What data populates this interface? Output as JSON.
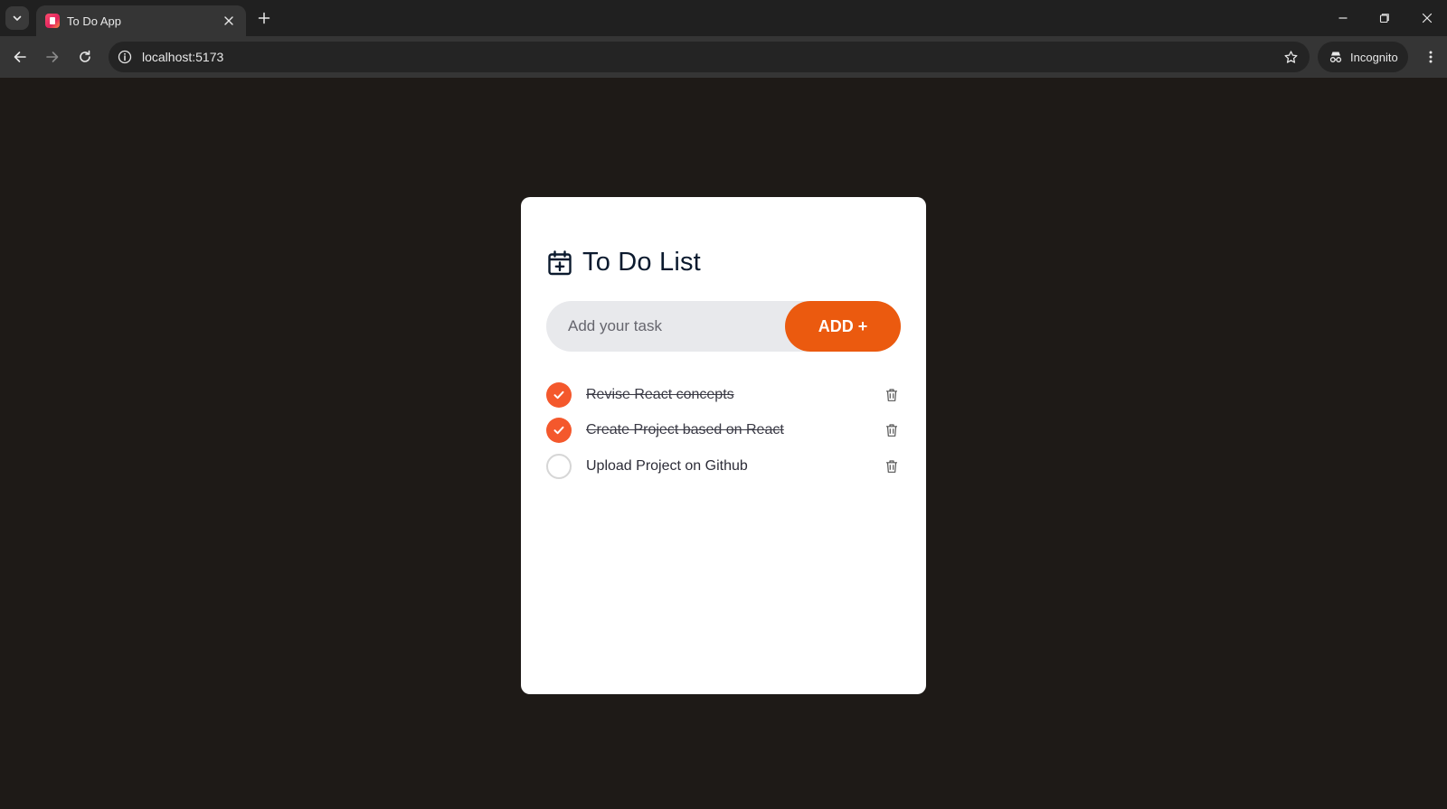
{
  "browser": {
    "tab_title": "To Do App",
    "url": "localhost:5173",
    "incognito_label": "Incognito"
  },
  "app": {
    "title": "To Do List",
    "input": {
      "placeholder": "Add your task",
      "value": ""
    },
    "add_button_label": "ADD +",
    "tasks": [
      {
        "text": "Revise React concepts",
        "completed": true
      },
      {
        "text": "Create Project based on React",
        "completed": true
      },
      {
        "text": "Upload Project on Github",
        "completed": false
      }
    ]
  },
  "colors": {
    "page_background": "#1e1a17",
    "accent": "#eb5a0f",
    "check_done": "#f4582c",
    "card_background": "#ffffff"
  },
  "icons": {
    "title_icon": "calendar-plus-icon",
    "task_done_icon": "check-icon",
    "task_delete_icon": "trash-icon"
  }
}
